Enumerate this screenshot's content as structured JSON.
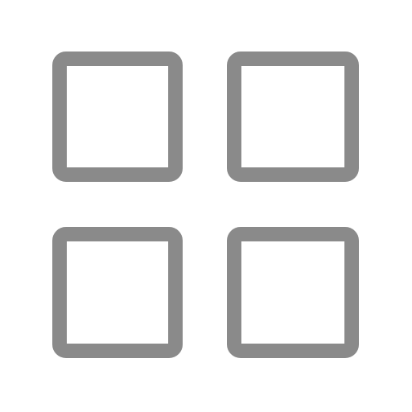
{
  "icon": {
    "name": "grid-icon",
    "stroke_color": "#8a8a8a",
    "background_color": "#ffffff",
    "cells": [
      {
        "name": "grid-cell-top-left"
      },
      {
        "name": "grid-cell-top-right"
      },
      {
        "name": "grid-cell-bottom-left"
      },
      {
        "name": "grid-cell-bottom-right"
      }
    ]
  }
}
